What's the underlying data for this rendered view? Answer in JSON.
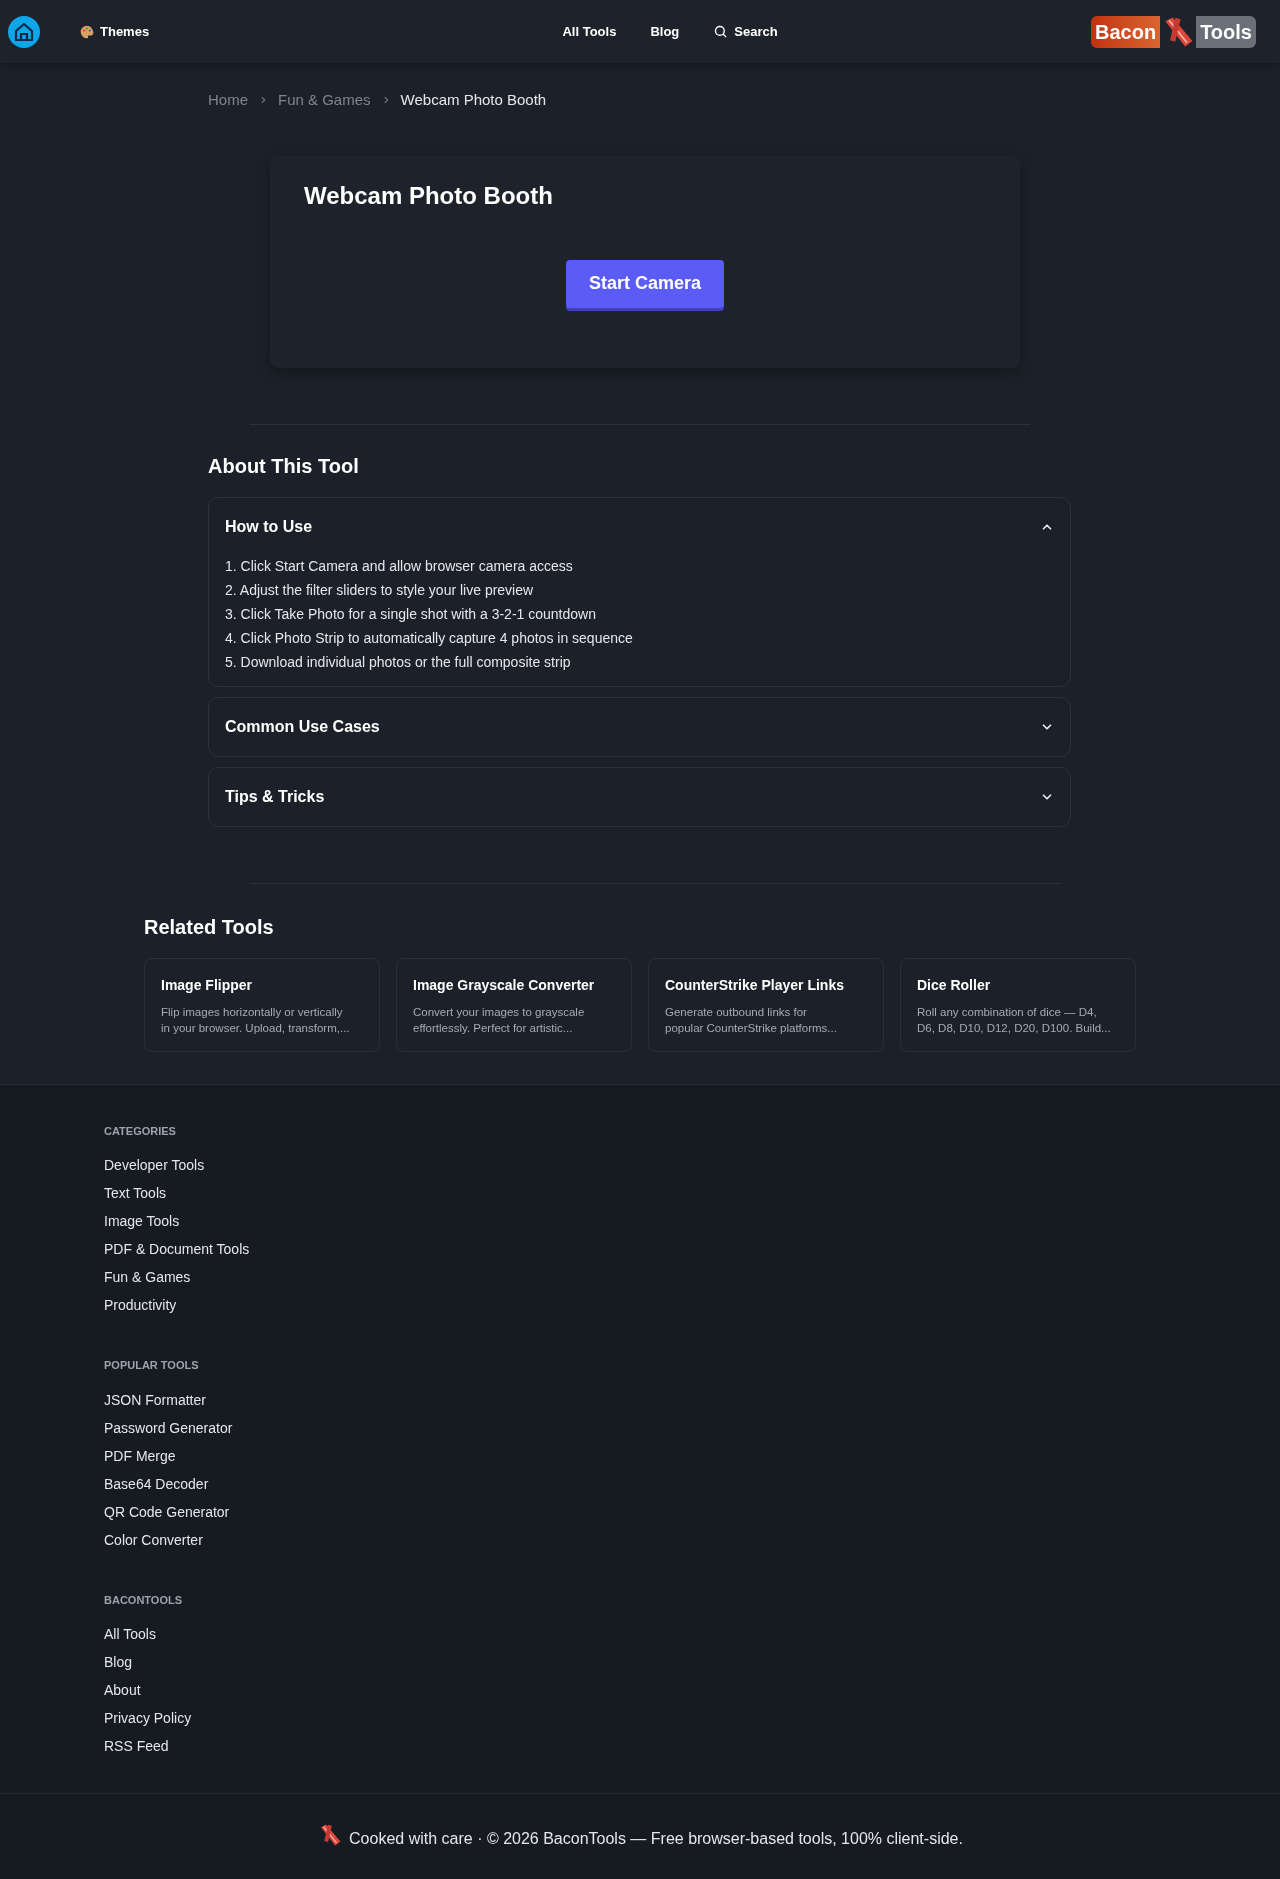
{
  "header": {
    "themes": "Themes",
    "nav": [
      "All Tools",
      "Blog"
    ],
    "search": "Search",
    "logo": {
      "left": "Bacon",
      "right": "Tools"
    }
  },
  "breadcrumb": [
    "Home",
    "Fun & Games",
    "Webcam Photo Booth"
  ],
  "tool": {
    "title": "Webcam Photo Booth",
    "button": "Start Camera"
  },
  "about": {
    "title": "About This Tool",
    "sections": [
      {
        "title": "How to Use",
        "expanded": true,
        "items": [
          "1. Click Start Camera and allow browser camera access",
          "2. Adjust the filter sliders to style your live preview",
          "3. Click Take Photo for a single shot with a 3-2-1 countdown",
          "4. Click Photo Strip to automatically capture 4 photos in sequence",
          "5. Download individual photos or the full composite strip"
        ]
      },
      {
        "title": "Common Use Cases",
        "expanded": false
      },
      {
        "title": "Tips & Tricks",
        "expanded": false
      }
    ]
  },
  "related": {
    "title": "Related Tools",
    "tools": [
      {
        "name": "Image Flipper",
        "lines": [
          "Flip images horizontally or vertically",
          "in your browser. Upload, transform,..."
        ]
      },
      {
        "name": "Image Grayscale Converter",
        "lines": [
          "Convert your images to grayscale",
          "effortlessly. Perfect for artistic..."
        ]
      },
      {
        "name": "CounterStrike Player Links",
        "lines": [
          "Generate outbound links for",
          "popular CounterStrike platforms..."
        ]
      },
      {
        "name": "Dice Roller",
        "lines": [
          "Roll any combination of dice — D4,",
          "D6, D8, D10, D12, D20, D100. Build..."
        ]
      }
    ]
  },
  "footer": {
    "sections": [
      {
        "heading": "CATEGORIES",
        "links": [
          "Developer Tools",
          "Text Tools",
          "Image Tools",
          "PDF & Document Tools",
          "Fun & Games",
          "Productivity"
        ]
      },
      {
        "heading": "POPULAR TOOLS",
        "links": [
          "JSON Formatter",
          "Password Generator",
          "PDF Merge",
          "Base64 Decoder",
          "QR Code Generator",
          "Color Converter"
        ]
      },
      {
        "heading": "BACONTOOLS",
        "links": [
          "All Tools",
          "Blog",
          "About",
          "Privacy Policy",
          "RSS Feed"
        ]
      }
    ],
    "copyright": "Cooked with care · © 2026 BaconTools — Free browser-based tools, 100% client-side."
  }
}
